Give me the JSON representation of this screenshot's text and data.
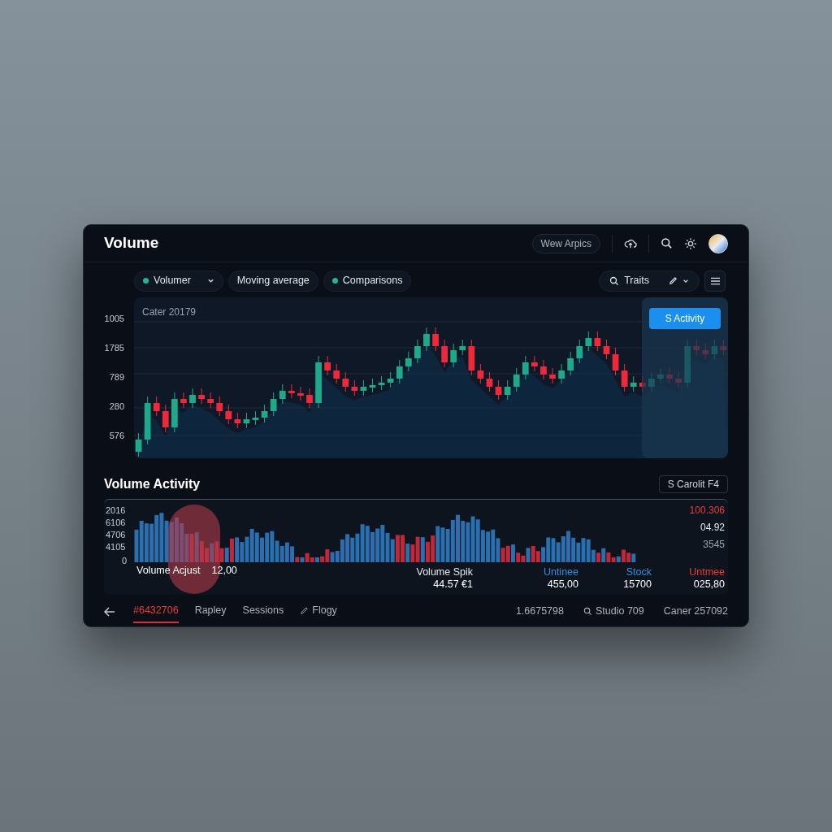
{
  "window": {
    "title": "Volume"
  },
  "header": {
    "pill": "Wew Arpics"
  },
  "toolbar": {
    "chips": [
      {
        "label": "Volumer",
        "kind": "dropdown"
      },
      {
        "label": "Moving average",
        "kind": "plain"
      },
      {
        "label": "Comparisons",
        "kind": "dot"
      }
    ],
    "search": "Traits"
  },
  "price_chart": {
    "label": "Cater 20179",
    "y_labels": [
      "1005",
      "1785",
      "789",
      "280",
      "576"
    ],
    "highlight_button": "S Activity"
  },
  "volume_section": {
    "title": "Volume Activity",
    "button": "S Carolit F4",
    "y_labels": [
      "2016",
      "6106",
      "4706",
      "4105",
      "0"
    ],
    "right_values": [
      {
        "text": "100.306",
        "color": "#ef3b3b"
      },
      {
        "text": "04.92",
        "color": "#e5e7eb"
      },
      {
        "text": "3545",
        "color": "#9ca3af"
      }
    ],
    "adjust": {
      "label": "Volume Acjust",
      "value": "12,00"
    },
    "stats": [
      {
        "label": "Volume Spik",
        "value": "44.57 €1",
        "color": "#e5e7eb"
      },
      {
        "label": "Untinee",
        "value": "455,00",
        "color": "#2f8fe0"
      },
      {
        "label": "Stock",
        "value": "15700",
        "color": "#2f8fe0"
      },
      {
        "label": "Untmee",
        "value": "025,80",
        "color": "#ef3b3b"
      }
    ]
  },
  "footer": {
    "tabs": [
      {
        "label": "#6432706",
        "selected": true,
        "kind": "text"
      },
      {
        "label": "Rapley",
        "selected": false,
        "kind": "text"
      },
      {
        "label": "Sessions",
        "selected": false,
        "kind": "text"
      },
      {
        "label": "Flogy",
        "selected": false,
        "kind": "pen"
      }
    ],
    "right": [
      {
        "text": "1.6675798",
        "kind": "text"
      },
      {
        "text": "Studio 709",
        "kind": "search"
      },
      {
        "text": "Caner 257092",
        "kind": "text"
      }
    ]
  }
}
